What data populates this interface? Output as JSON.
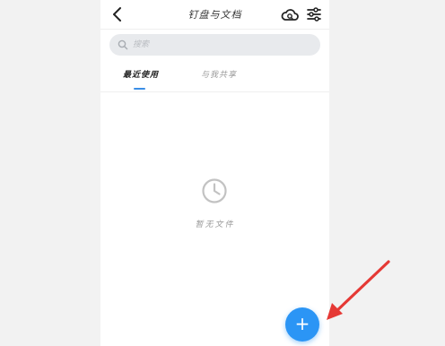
{
  "header": {
    "title": "钉盘与文档",
    "back_icon": "chevron-left-icon",
    "cloud_icon": "cloud-icon",
    "settings_icon": "sliders-icon"
  },
  "search": {
    "placeholder": "搜索",
    "value": ""
  },
  "tabs": [
    {
      "label": "最近使用",
      "active": true
    },
    {
      "label": "与我共享",
      "active": false
    }
  ],
  "empty_state": {
    "icon": "clock-icon",
    "text": "暂无文件"
  },
  "fab": {
    "label": "+",
    "color": "#2b95f5"
  },
  "annotation": {
    "arrow_color": "#e53935"
  }
}
